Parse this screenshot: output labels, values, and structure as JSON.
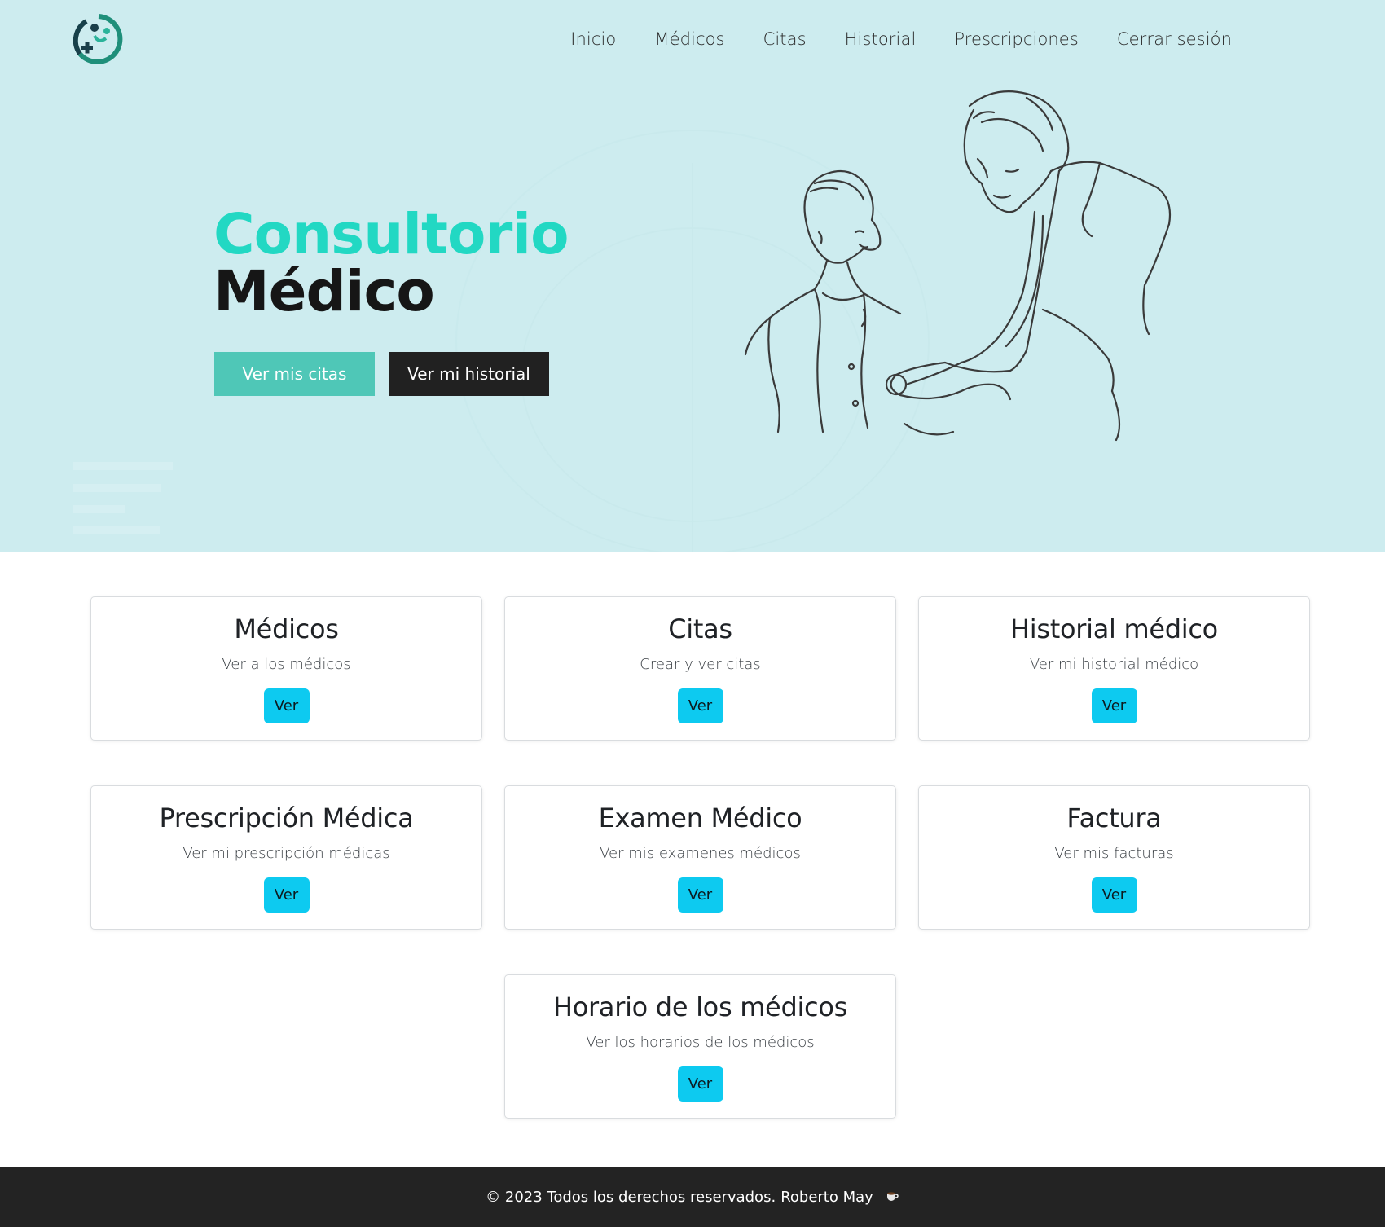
{
  "nav": {
    "items": [
      {
        "label": "Inicio"
      },
      {
        "label": "Médicos"
      },
      {
        "label": "Citas"
      },
      {
        "label": "Historial"
      },
      {
        "label": "Prescripciones"
      },
      {
        "label": "Cerrar sesión"
      }
    ]
  },
  "hero": {
    "title_line1": "Consultorio",
    "title_line2": "Médico",
    "btn_citas": "Ver mis citas",
    "btn_historial": "Ver mi historial"
  },
  "cards": [
    {
      "title": "Médicos",
      "text": "Ver a los médicos",
      "button": "Ver"
    },
    {
      "title": "Citas",
      "text": "Crear y ver citas",
      "button": "Ver"
    },
    {
      "title": "Historial médico",
      "text": "Ver mi historial médico",
      "button": "Ver"
    },
    {
      "title": "Prescripción Médica",
      "text": "Ver mi prescripción médicas",
      "button": "Ver"
    },
    {
      "title": "Examen Médico",
      "text": "Ver mis examenes médicos",
      "button": "Ver"
    },
    {
      "title": "Factura",
      "text": "Ver mis facturas",
      "button": "Ver"
    },
    {
      "title": "Horario de los médicos",
      "text": "Ver los horarios de los médicos",
      "button": "Ver"
    }
  ],
  "footer": {
    "text": "© 2023 Todos los derechos reservados.",
    "author": "Roberto May"
  },
  "colors": {
    "hero_bg": "#cdecef",
    "accent_teal": "#22d8c3",
    "btn_citas": "#4fc7b7",
    "btn_dark": "#212121",
    "card_btn": "#0dcaf0",
    "footer_bg": "#232323"
  }
}
